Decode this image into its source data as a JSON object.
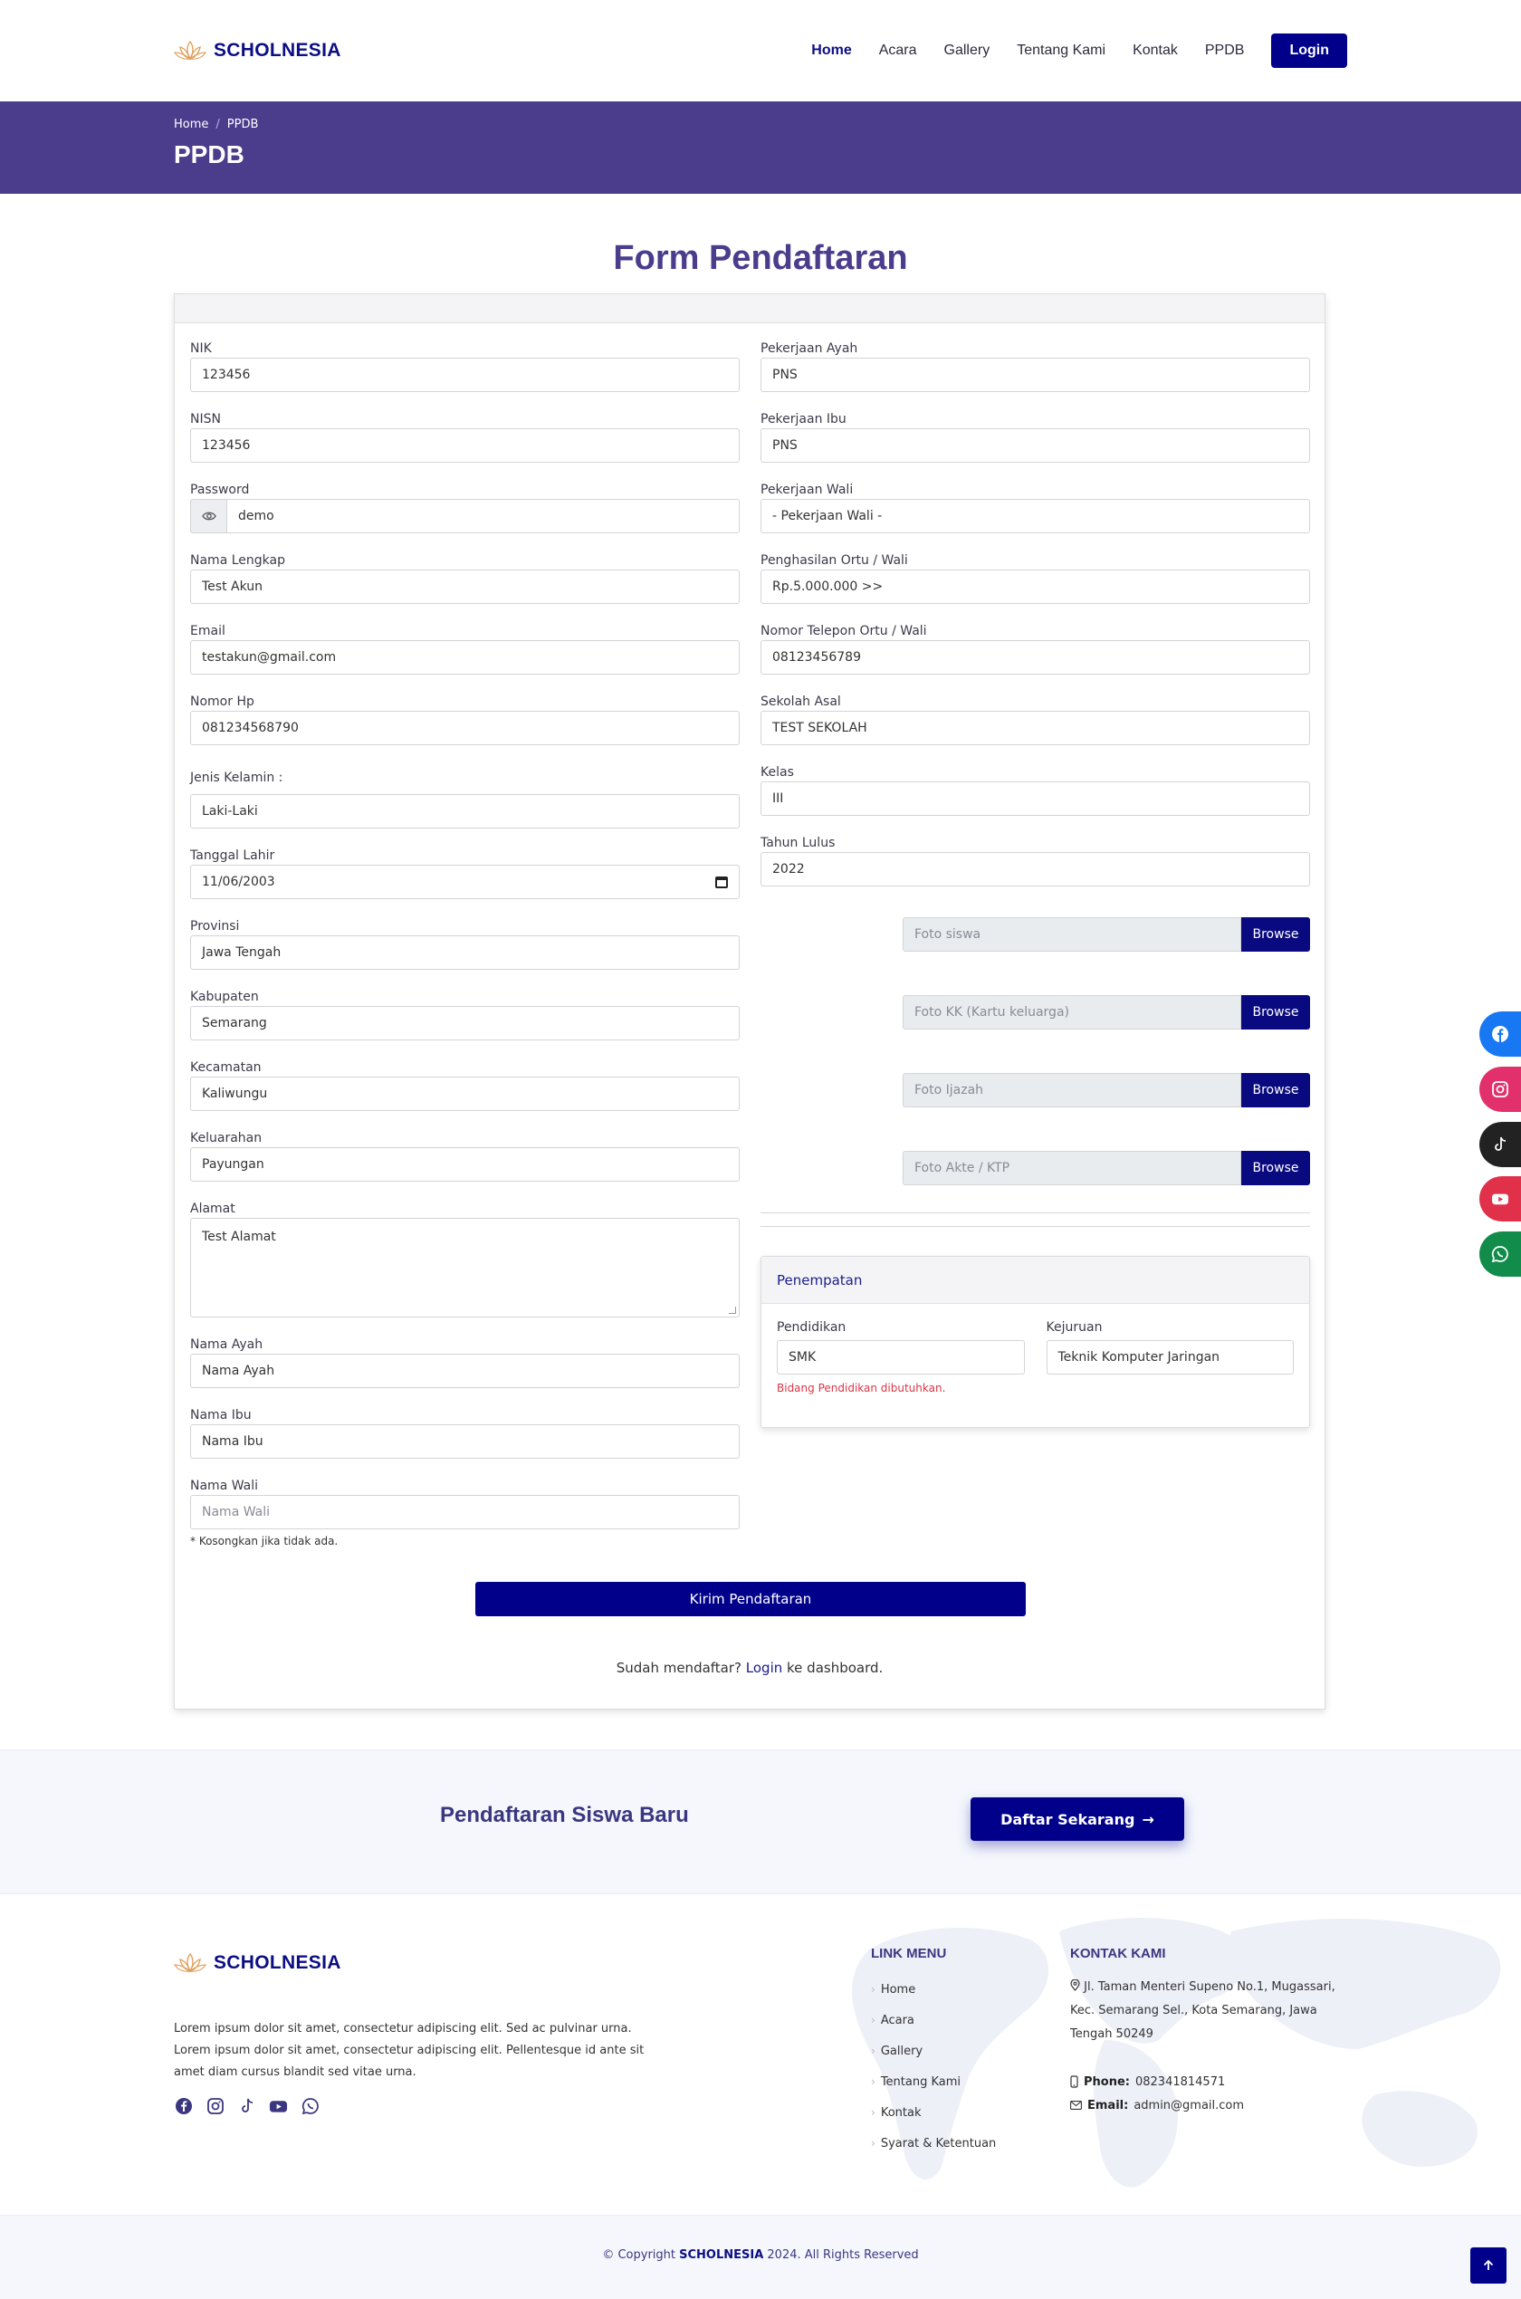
{
  "brand": {
    "name": "SCHOLNESIA"
  },
  "nav": {
    "items": [
      "Home",
      "Acara",
      "Gallery",
      "Tentang Kami",
      "Kontak",
      "PPDB"
    ],
    "login": "Login"
  },
  "titlebar": {
    "crumb_home": "Home",
    "crumb_sep": "/",
    "crumb_current": "PPDB",
    "title": "PPDB"
  },
  "form": {
    "heading": "Form Pendaftaran",
    "left": {
      "nik": {
        "label": "NIK",
        "value": "123456"
      },
      "nisn": {
        "label": "NISN",
        "value": "123456"
      },
      "password": {
        "label": "Password",
        "value": "demo"
      },
      "nama": {
        "label": "Nama Lengkap",
        "value": "Test Akun"
      },
      "email": {
        "label": "Email",
        "value": "testakun@gmail.com"
      },
      "hp": {
        "label": "Nomor Hp",
        "value": "081234568790"
      },
      "jk": {
        "label": "Jenis Kelamin :",
        "value": "Laki-Laki"
      },
      "tgl": {
        "label": "Tanggal Lahir",
        "value": "11/06/2003"
      },
      "provinsi": {
        "label": "Provinsi",
        "value": "Jawa Tengah"
      },
      "kabupaten": {
        "label": "Kabupaten",
        "value": "Semarang"
      },
      "kecamatan": {
        "label": "Kecamatan",
        "value": "Kaliwungu"
      },
      "kelurahan": {
        "label": "Keluarahan",
        "value": "Payungan"
      },
      "alamat": {
        "label": "Alamat",
        "value": "Test Alamat"
      },
      "ayah": {
        "label": "Nama Ayah",
        "value": "Nama Ayah"
      },
      "ibu": {
        "label": "Nama Ibu",
        "value": "Nama Ibu"
      },
      "wali": {
        "label": "Nama Wali",
        "placeholder": "Nama Wali",
        "hint": "* Kosongkan jika tidak ada."
      }
    },
    "right": {
      "kerja_ayah": {
        "label": "Pekerjaan Ayah",
        "value": "PNS"
      },
      "kerja_ibu": {
        "label": "Pekerjaan Ibu",
        "value": "PNS"
      },
      "kerja_wali": {
        "label": "Pekerjaan Wali",
        "value": "- Pekerjaan Wali -"
      },
      "penghasilan": {
        "label": "Penghasilan Ortu / Wali",
        "value": "Rp.5.000.000 >>"
      },
      "telp_ortu": {
        "label": "Nomor Telepon Ortu / Wali",
        "value": "08123456789"
      },
      "sekolah": {
        "label": "Sekolah Asal",
        "value": "TEST SEKOLAH"
      },
      "kelas": {
        "label": "Kelas",
        "value": "III"
      },
      "lulus": {
        "label": "Tahun Lulus",
        "value": "2022"
      },
      "files": [
        "Foto siswa",
        "Foto KK (Kartu keluarga)",
        "Foto Ijazah",
        "Foto Akte / KTP"
      ],
      "browse": "Browse"
    },
    "penempatan": {
      "title": "Penempatan",
      "pendidikan": {
        "label": "Pendidikan",
        "value": "SMK",
        "error": "Bidang Pendidikan dibutuhkan."
      },
      "kejuruan": {
        "label": "Kejuruan",
        "value": "Teknik Komputer Jaringan"
      }
    },
    "submit": "Kirim Pendaftaran",
    "login_note": {
      "before": "Sudah mendaftar? ",
      "link": "Login",
      "after": " ke dashboard."
    }
  },
  "cta": {
    "text": "Pendaftaran Siswa Baru",
    "button": "Daftar Sekarang",
    "arrow": "→"
  },
  "footer": {
    "about": "Lorem ipsum dolor sit amet, consectetur adipiscing elit. Sed ac pulvinar urna. Lorem ipsum dolor sit amet, consectetur adipiscing elit. Pellentesque id ante sit amet diam cursus blandit sed vitae urna.",
    "links_title": "LINK MENU",
    "links": [
      "Home",
      "Acara",
      "Gallery",
      "Tentang Kami",
      "Kontak",
      "Syarat & Ketentuan"
    ],
    "contact_title": "KONTAK KAMI",
    "address": "Jl. Taman Menteri Supeno No.1, Mugassari, Kec. Semarang Sel., Kota Semarang, Jawa Tengah 50249",
    "phone_label": "Phone:",
    "phone": "082341814571",
    "email_label": "Email:",
    "email": "admin@gmail.com",
    "copy_before": "© Copyright ",
    "copy_brand": "SCHOLNESIA",
    "copy_after": " 2024. All Rights Reserved"
  },
  "icons": {
    "float": [
      "facebook-icon",
      "instagram-icon",
      "tiktok-icon",
      "youtube-icon",
      "whatsapp-icon"
    ],
    "colors": {
      "facebook": "#1877f2",
      "instagram": "#e1306c",
      "tiktok": "#222222",
      "youtube": "#e0304a",
      "whatsapp": "#128c4a"
    }
  }
}
